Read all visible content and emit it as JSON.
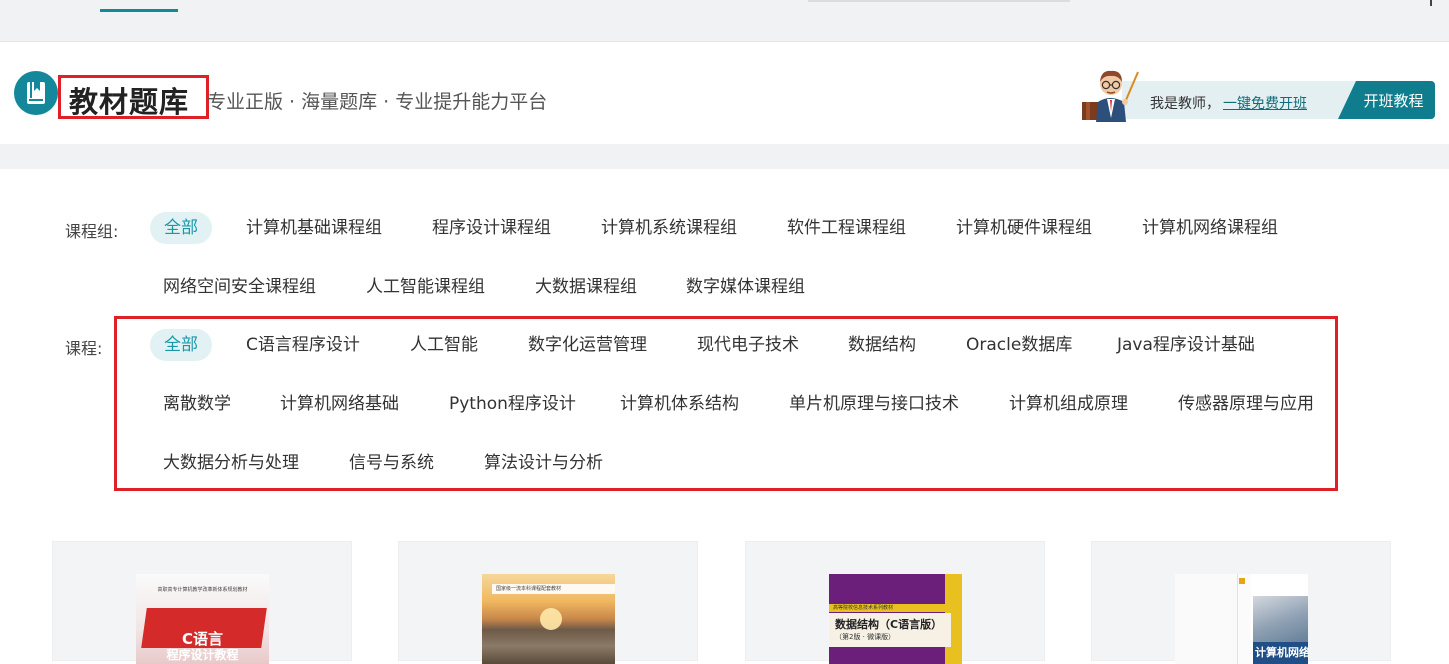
{
  "header": {
    "title": "教材题库",
    "slogan": "专业正版 · 海量题库 · 专业提升能力平台",
    "teacher_text": "我是教师，",
    "teacher_link": "一键免费开班",
    "open_tutorial": "开班教程"
  },
  "filters": {
    "course_group_label": "课程组:",
    "course_groups": [
      "全部",
      "计算机基础课程组",
      "程序设计课程组",
      "计算机系统课程组",
      "软件工程课程组",
      "计算机硬件课程组",
      "计算机网络课程组",
      "网络空间安全课程组",
      "人工智能课程组",
      "大数据课程组",
      "数字媒体课程组"
    ],
    "course_label": "课程:",
    "courses": [
      "全部",
      "C语言程序设计",
      "人工智能",
      "数字化运营管理",
      "现代电子技术",
      "数据结构",
      "Oracle数据库",
      "Java程序设计基础",
      "离散数学",
      "计算机网络基础",
      "Python程序设计",
      "计算机体系结构",
      "单片机原理与接口技术",
      "计算机组成原理",
      "传感器原理与应用",
      "大数据分析与处理",
      "信号与系统",
      "算法设计与分析"
    ]
  },
  "books": [
    {
      "series": "高职高专计算机教学改革新体系规划教材",
      "title": "C语言",
      "subtitle": "程序设计教程"
    },
    {
      "series": "国家级一流本科课程配套教材"
    },
    {
      "series": "高等院校信息技术系列教材",
      "title": "数据结构（C语言版）",
      "subtitle": "（第2版 · 微课版）"
    },
    {
      "title": "计算机网络"
    }
  ],
  "colors": {
    "accent": "#0f7d8d",
    "active_chip_bg": "#e2f1f4",
    "highlight_box": "#e02027"
  }
}
